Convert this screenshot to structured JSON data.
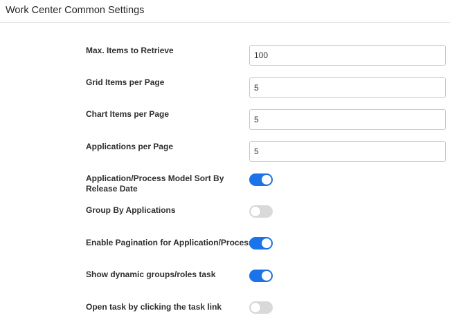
{
  "header": {
    "title": "Work Center Common Settings"
  },
  "settings": {
    "max_items": {
      "label": "Max. Items to Retrieve",
      "value": "100"
    },
    "grid_items": {
      "label": "Grid Items per Page",
      "value": "5"
    },
    "chart_items": {
      "label": "Chart Items per Page",
      "value": "5"
    },
    "applications_per_page": {
      "label": "Applications per Page",
      "value": "5"
    },
    "sort_by_release_date": {
      "label": "Application/Process Model Sort By Release Date",
      "enabled": true
    },
    "group_by_applications": {
      "label": "Group By Applications",
      "enabled": false
    },
    "enable_pagination": {
      "label": "Enable Pagination for Application/Process",
      "enabled": true
    },
    "show_dynamic_groups": {
      "label": "Show dynamic groups/roles task",
      "enabled": true
    },
    "open_task_by_link": {
      "label": "Open task by clicking the task link",
      "enabled": false
    }
  },
  "colors": {
    "toggle_on": "#1a73e8",
    "toggle_off": "#d9d9d9"
  }
}
